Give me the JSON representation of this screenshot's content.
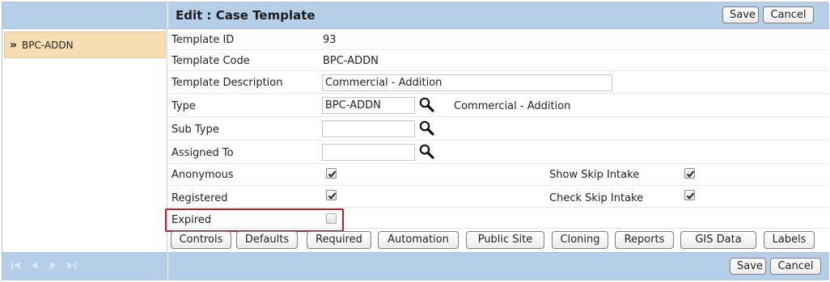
{
  "page": {
    "title": "Edit : Case Template"
  },
  "toolbar": {
    "save_label": "Save",
    "cancel_label": "Cancel"
  },
  "sidebar": {
    "items": [
      {
        "label": "BPC-ADDN"
      }
    ]
  },
  "form": {
    "template_id": {
      "label": "Template ID",
      "value": "93"
    },
    "template_code": {
      "label": "Template Code",
      "value": "BPC-ADDN"
    },
    "template_description": {
      "label": "Template Description",
      "value": "Commercial - Addition"
    },
    "type": {
      "label": "Type",
      "value": "BPC-ADDN",
      "description": "Commercial - Addition"
    },
    "sub_type": {
      "label": "Sub Type",
      "value": ""
    },
    "assigned_to": {
      "label": "Assigned To",
      "value": ""
    },
    "anonymous": {
      "label": "Anonymous",
      "checked": true
    },
    "show_skip_intake": {
      "label": "Show Skip Intake",
      "checked": true
    },
    "registered": {
      "label": "Registered",
      "checked": true
    },
    "check_skip_intake": {
      "label": "Check Skip Intake",
      "checked": true
    },
    "expired": {
      "label": "Expired",
      "checked": false
    }
  },
  "sections": [
    {
      "label": "Controls"
    },
    {
      "label": "Defaults"
    },
    {
      "label": "Required"
    },
    {
      "label": "Automation"
    },
    {
      "label": "Public Site"
    },
    {
      "label": "Cloning"
    },
    {
      "label": "Reports"
    },
    {
      "label": "GIS Data"
    },
    {
      "label": "Labels"
    }
  ],
  "pager": {
    "icons": [
      "first-page-icon",
      "prev-page-icon",
      "next-page-icon",
      "last-page-icon"
    ]
  },
  "colors": {
    "header_bg": "#b6cfe9",
    "selected_item_bg": "#f6deb2",
    "highlight_border": "#b0242a"
  }
}
